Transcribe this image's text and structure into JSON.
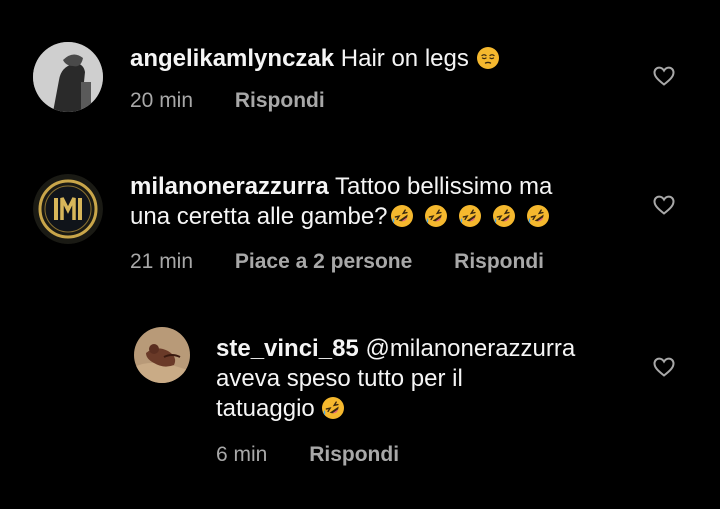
{
  "comments": [
    {
      "username": "angelikamlynczak",
      "text": " Hair on legs ",
      "emoji": [
        "pensive-face"
      ],
      "time": "20 min",
      "reply": "Rispondi",
      "likes": ""
    },
    {
      "username": "milanonerazzurra",
      "text_line1": " Tattoo bellissimo ma",
      "text_line2": "una ceretta alle gambe?",
      "emoji": [
        "rolling-laughing-face",
        "rolling-laughing-face",
        "rolling-laughing-face",
        "rolling-laughing-face",
        "rolling-laughing-face"
      ],
      "time": "21 min",
      "likes": "Piace a 2 persone",
      "reply": "Rispondi"
    },
    {
      "username": "ste_vinci_85",
      "mention": " @milanonerazzurra",
      "text_line2": "aveva speso tutto per il",
      "text_line3": "tatuaggio ",
      "emoji": [
        "rolling-laughing-face"
      ],
      "time": "6 min",
      "reply": "Rispondi"
    }
  ],
  "icons": {
    "like": "heart-outline-icon"
  },
  "colors": {
    "background": "#000000",
    "text": "#f5f5f5",
    "meta": "#a8a8a8",
    "emoji": "#f5b82e"
  }
}
